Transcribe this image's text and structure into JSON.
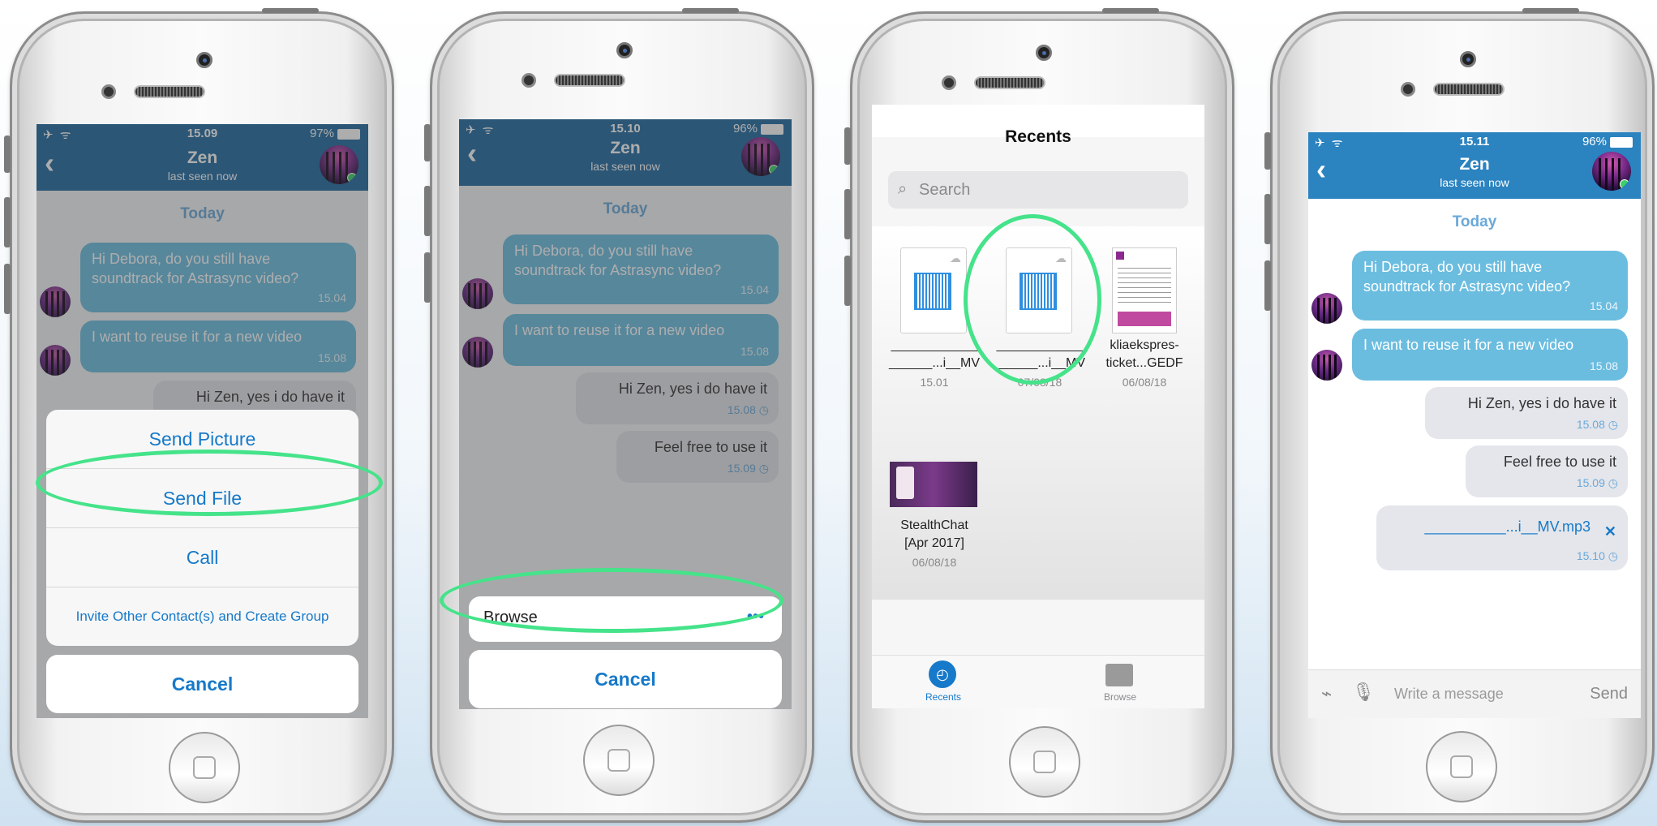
{
  "phone1": {
    "status": {
      "icons": "✈ ᯤ",
      "time": "15.09",
      "battery": "97%"
    },
    "chat": {
      "name": "Zen",
      "last_seen": "last seen now",
      "day": "Today"
    },
    "messages": [
      {
        "text": "Hi Debora, do you still have soundtrack for Astrasync video?",
        "time": "15.04"
      },
      {
        "text": "I want to reuse it for a new video",
        "time": "15.08"
      },
      {
        "text": "Hi Zen, yes i do have it"
      }
    ],
    "menu": {
      "send_picture": "Send Picture",
      "send_file": "Send File",
      "call": "Call",
      "invite": "Invite Other Contact(s) and Create Group",
      "cancel": "Cancel"
    }
  },
  "phone2": {
    "status": {
      "icons": "✈ ᯤ",
      "time": "15.10",
      "battery": "96%"
    },
    "chat": {
      "name": "Zen",
      "last_seen": "last seen now",
      "day": "Today"
    },
    "messages": [
      {
        "text": "Hi Debora, do you still have soundtrack for Astrasync video?",
        "time": "15.04"
      },
      {
        "text": "I want to reuse it for a new video",
        "time": "15.08"
      },
      {
        "text": "Hi Zen, yes i do have it",
        "time": "15.08"
      },
      {
        "text": "Feel free to use it",
        "time": "15.09"
      }
    ],
    "browse": {
      "label": "Browse",
      "more": "•••"
    },
    "cancel": "Cancel"
  },
  "phone3": {
    "title": "Recents",
    "search_placeholder": "Search",
    "files": [
      {
        "name_line1": "____________",
        "name_line2": "______...i__MV",
        "date": "15.01"
      },
      {
        "name_line1": "____________",
        "name_line2": "______...i__MV",
        "date": "07/08/18"
      },
      {
        "name_line1": "kliaekspres-",
        "name_line2": "ticket...GEDF",
        "date": "06/08/18"
      },
      {
        "name_line1": "StealthChat",
        "name_line2": "[Apr 2017]",
        "date": "06/08/18"
      }
    ],
    "tabs": {
      "recents": "Recents",
      "browse": "Browse"
    }
  },
  "phone4": {
    "status": {
      "icons": "✈ ᯤ",
      "time": "15.11",
      "battery": "96%"
    },
    "chat": {
      "name": "Zen",
      "last_seen": "last seen now",
      "day": "Today"
    },
    "messages": [
      {
        "text": "Hi Debora, do you still have soundtrack for Astrasync video?",
        "time": "15.04"
      },
      {
        "text": "I want to reuse it for a new video",
        "time": "15.08"
      },
      {
        "text": "Hi Zen, yes i do have it",
        "time": "15.08"
      },
      {
        "text": "Feel free to use it",
        "time": "15.09"
      },
      {
        "text": "__________...i__MV.mp3",
        "time": "15.10"
      }
    ],
    "composer": {
      "placeholder": "Write a message",
      "send": "Send"
    }
  },
  "colors": {
    "navbar": "#1f6aa0",
    "incoming": "#6bbde0",
    "outgoing": "#e4e6eb",
    "accent": "#1679c9",
    "highlight": "#45e38a"
  }
}
